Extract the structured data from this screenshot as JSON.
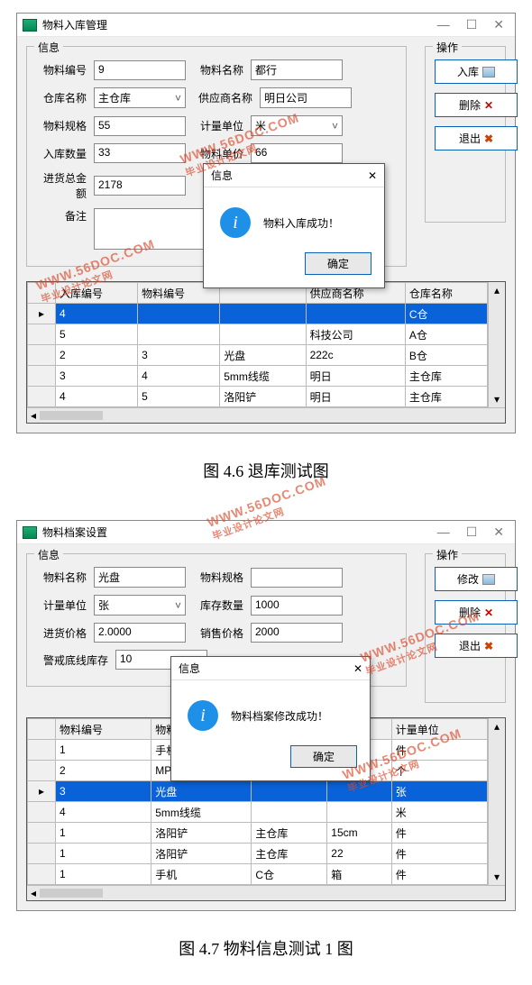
{
  "caption1": "图 4.6 退库测试图",
  "caption2": "图 4.7 物料信息测试 1 图",
  "watermark": {
    "big": "WWW.56DOC.COM",
    "small": "毕业设计论文网"
  },
  "win1": {
    "title": "物料入库管理",
    "info_legend": "信息",
    "op_legend": "操作",
    "labels": {
      "mat_id": "物料编号",
      "mat_name": "物料名称",
      "wh_name": "仓库名称",
      "supplier": "供应商名称",
      "spec": "物料规格",
      "unit": "计量单位",
      "in_qty": "入库数量",
      "price": "物料单价",
      "total": "进货总金额",
      "remark": "备注"
    },
    "values": {
      "mat_id": "9",
      "mat_name": "都行",
      "wh_name": "主仓库",
      "supplier": "明日公司",
      "spec": "55",
      "unit": "米",
      "in_qty": "33",
      "price": "66",
      "total": "2178"
    },
    "ops": {
      "in": "入库",
      "del": "删除",
      "exit": "退出"
    },
    "dialog": {
      "title": "信息",
      "msg": "物料入库成功！",
      "ok": "确定"
    },
    "headers": [
      "入库编号",
      "物料编号",
      "",
      "供应商名称",
      "仓库名称"
    ],
    "rows": [
      {
        "sel": true,
        "c": [
          "4",
          "",
          "",
          "",
          "C仓"
        ]
      },
      {
        "c": [
          "5",
          "",
          "",
          "科技公司",
          "A仓"
        ]
      },
      {
        "c": [
          "2",
          "3",
          "",
          "光盘",
          "222c",
          "B仓"
        ]
      },
      {
        "c": [
          "3",
          "4",
          "",
          "5mm线缆",
          "明日",
          "主仓库"
        ]
      },
      {
        "c": [
          "4",
          "5",
          "",
          "洛阳铲",
          "明日",
          "主仓库"
        ]
      }
    ]
  },
  "win2": {
    "title": "物料档案设置",
    "info_legend": "信息",
    "op_legend": "操作",
    "labels": {
      "mat_name": "物料名称",
      "spec": "物料规格",
      "unit": "计量单位",
      "stock": "库存数量",
      "in_price": "进货价格",
      "sell_price": "销售价格",
      "alarm": "警戒底线库存"
    },
    "values": {
      "mat_name": "光盘",
      "spec": "",
      "unit": "张",
      "stock": "1000",
      "in_price": "2.0000",
      "sell_price": "2000",
      "alarm": "10"
    },
    "ops": {
      "edit": "修改",
      "del": "删除",
      "exit": "退出"
    },
    "dialog": {
      "title": "信息",
      "msg": "物料档案修改成功！",
      "ok": "确定"
    },
    "headers": [
      "物料编号",
      "物料名称",
      "",
      "",
      "计量单位"
    ],
    "rows": [
      {
        "c": [
          "1",
          "手机",
          "",
          "",
          "件"
        ]
      },
      {
        "c": [
          "2",
          "MP3",
          "",
          "",
          "个"
        ]
      },
      {
        "sel": true,
        "c": [
          "3",
          "光盘",
          "",
          "",
          "张"
        ]
      },
      {
        "c": [
          "4",
          "5mm线缆",
          "",
          "",
          "米"
        ]
      },
      {
        "c": [
          "1",
          "洛阳铲",
          "主仓库",
          "15cm",
          "件"
        ]
      },
      {
        "c": [
          "1",
          "洛阳铲",
          "主仓库",
          "22",
          "件"
        ]
      },
      {
        "c": [
          "1",
          "手机",
          "C仓",
          "箱",
          "件"
        ]
      }
    ]
  }
}
